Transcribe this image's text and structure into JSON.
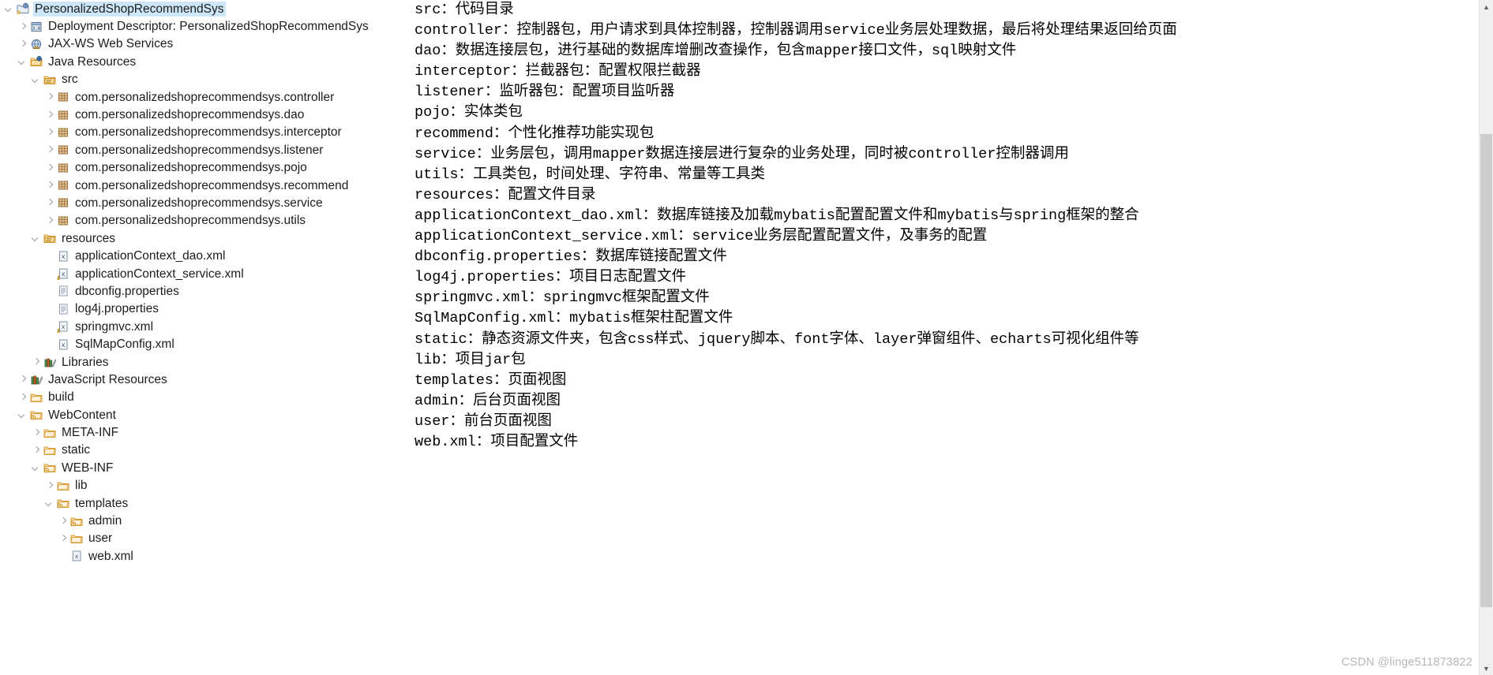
{
  "explorer": {
    "name": "project-explorer",
    "tree": [
      {
        "label": "PersonalizedShopRecommendSys",
        "indent": 0,
        "twisty": "expanded",
        "icon": "dynamic-web-project-icon",
        "selected": true
      },
      {
        "label": "Deployment Descriptor: PersonalizedShopRecommendSys",
        "indent": 1,
        "twisty": "collapsed",
        "icon": "deployment-descriptor-icon",
        "selected": false
      },
      {
        "label": "JAX-WS Web Services",
        "indent": 1,
        "twisty": "collapsed",
        "icon": "web-services-icon",
        "selected": false
      },
      {
        "label": "Java Resources",
        "indent": 1,
        "twisty": "expanded",
        "icon": "java-resources-icon",
        "selected": false
      },
      {
        "label": "src",
        "indent": 2,
        "twisty": "expanded",
        "icon": "source-folder-icon",
        "selected": false
      },
      {
        "label": "com.personalizedshoprecommendsys.controller",
        "indent": 3,
        "twisty": "collapsed",
        "icon": "package-icon",
        "selected": false
      },
      {
        "label": "com.personalizedshoprecommendsys.dao",
        "indent": 3,
        "twisty": "collapsed",
        "icon": "package-icon",
        "selected": false
      },
      {
        "label": "com.personalizedshoprecommendsys.interceptor",
        "indent": 3,
        "twisty": "collapsed",
        "icon": "package-icon",
        "selected": false
      },
      {
        "label": "com.personalizedshoprecommendsys.listener",
        "indent": 3,
        "twisty": "collapsed",
        "icon": "package-icon",
        "selected": false
      },
      {
        "label": "com.personalizedshoprecommendsys.pojo",
        "indent": 3,
        "twisty": "collapsed",
        "icon": "package-icon",
        "selected": false
      },
      {
        "label": "com.personalizedshoprecommendsys.recommend",
        "indent": 3,
        "twisty": "collapsed",
        "icon": "package-icon",
        "selected": false
      },
      {
        "label": "com.personalizedshoprecommendsys.service",
        "indent": 3,
        "twisty": "collapsed",
        "icon": "package-icon",
        "selected": false
      },
      {
        "label": "com.personalizedshoprecommendsys.utils",
        "indent": 3,
        "twisty": "collapsed",
        "icon": "package-icon",
        "selected": false
      },
      {
        "label": "resources",
        "indent": 2,
        "twisty": "expanded",
        "icon": "source-folder-icon",
        "selected": false
      },
      {
        "label": "applicationContext_dao.xml",
        "indent": 3,
        "twisty": "none",
        "icon": "xml-file-icon",
        "selected": false
      },
      {
        "label": "applicationContext_service.xml",
        "indent": 3,
        "twisty": "none",
        "icon": "xml-file-warning-icon",
        "selected": false
      },
      {
        "label": "dbconfig.properties",
        "indent": 3,
        "twisty": "none",
        "icon": "properties-file-icon",
        "selected": false
      },
      {
        "label": "log4j.properties",
        "indent": 3,
        "twisty": "none",
        "icon": "properties-file-icon",
        "selected": false
      },
      {
        "label": "springmvc.xml",
        "indent": 3,
        "twisty": "none",
        "icon": "xml-file-warning-icon",
        "selected": false
      },
      {
        "label": "SqlMapConfig.xml",
        "indent": 3,
        "twisty": "none",
        "icon": "xml-file-icon",
        "selected": false
      },
      {
        "label": "Libraries",
        "indent": 2,
        "twisty": "collapsed",
        "icon": "libraries-icon",
        "selected": false
      },
      {
        "label": "JavaScript Resources",
        "indent": 1,
        "twisty": "collapsed",
        "icon": "libraries-icon",
        "selected": false
      },
      {
        "label": "build",
        "indent": 1,
        "twisty": "collapsed",
        "icon": "folder-icon",
        "selected": false
      },
      {
        "label": "WebContent",
        "indent": 1,
        "twisty": "expanded",
        "icon": "web-folder-icon",
        "selected": false
      },
      {
        "label": "META-INF",
        "indent": 2,
        "twisty": "collapsed",
        "icon": "folder-icon",
        "selected": false
      },
      {
        "label": "static",
        "indent": 2,
        "twisty": "collapsed",
        "icon": "folder-icon",
        "selected": false
      },
      {
        "label": "WEB-INF",
        "indent": 2,
        "twisty": "expanded",
        "icon": "web-folder-icon",
        "selected": false
      },
      {
        "label": "lib",
        "indent": 3,
        "twisty": "collapsed",
        "icon": "folder-icon",
        "selected": false
      },
      {
        "label": "templates",
        "indent": 3,
        "twisty": "expanded",
        "icon": "web-folder-icon",
        "selected": false
      },
      {
        "label": "admin",
        "indent": 4,
        "twisty": "collapsed",
        "icon": "web-folder-icon",
        "selected": false
      },
      {
        "label": "user",
        "indent": 4,
        "twisty": "collapsed",
        "icon": "folder-icon",
        "selected": false
      },
      {
        "label": "web.xml",
        "indent": 4,
        "twisty": "none",
        "icon": "xml-file-icon",
        "selected": false
      }
    ]
  },
  "description": {
    "lines": [
      {
        "text": "src：代码目录",
        "wrap": false
      },
      {
        "text": "controller：控制器包，用户请求到具体控制器，控制器调用service业务层处理数据，最后将处理结果返回给页面",
        "wrap": true
      },
      {
        "text": "dao：数据连接层包，进行基础的数据库增删改查操作，包含mapper接口文件，sql映射文件",
        "wrap": false
      },
      {
        "text": "interceptor：拦截器包：配置权限拦截器",
        "wrap": false
      },
      {
        "text": "listener：监听器包：配置项目监听器",
        "wrap": false
      },
      {
        "text": "pojo：实体类包",
        "wrap": false
      },
      {
        "text": "recommend：个性化推荐功能实现包",
        "wrap": false
      },
      {
        "text": "service：业务层包，调用mapper数据连接层进行复杂的业务处理，同时被controller控制器调用",
        "wrap": false
      },
      {
        "text": "utils：工具类包，时间处理、字符串、常量等工具类",
        "wrap": false
      },
      {
        "text": "resources：配置文件目录",
        "wrap": false
      },
      {
        "text": "applicationContext_dao.xml：数据库链接及加载mybatis配置配置文件和mybatis与spring框架的整合",
        "wrap": false
      },
      {
        "text": "applicationContext_service.xml：service业务层配置配置文件，及事务的配置",
        "wrap": false
      },
      {
        "text": "dbconfig.properties：数据库链接配置文件",
        "wrap": false
      },
      {
        "text": "log4j.properties：项目日志配置文件",
        "wrap": false
      },
      {
        "text": "springmvc.xml：springmvc框架配置文件",
        "wrap": false
      },
      {
        "text": "SqlMapConfig.xml：mybatis框架柱配置文件",
        "wrap": false
      },
      {
        "text": "static：静态资源文件夹，包含css样式、jquery脚本、font字体、layer弹窗组件、echarts可视化组件等",
        "wrap": false
      },
      {
        "text": "lib：项目jar包",
        "wrap": false
      },
      {
        "text": "templates：页面视图",
        "wrap": false
      },
      {
        "text": "admin：后台页面视图",
        "wrap": false
      },
      {
        "text": "user：前台页面视图",
        "wrap": false
      },
      {
        "text": "web.xml：项目配置文件",
        "wrap": false
      }
    ]
  },
  "scrollbar": {
    "up_glyph": "▲",
    "down_glyph": "▼"
  },
  "watermark": {
    "text": "CSDN @linge511873822"
  },
  "colors": {
    "selection": "#cde6f7",
    "folder": "#f0b254",
    "package": "#c8a070",
    "library": "#3a7a3a",
    "scrollbar_track": "#f0f0f0",
    "scrollbar_thumb": "#cdcdcd",
    "watermark": "#b6b6b6"
  }
}
